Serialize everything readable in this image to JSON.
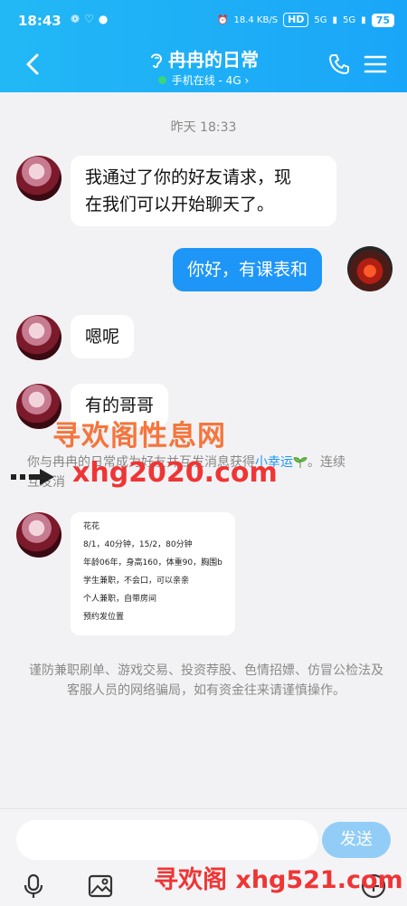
{
  "status_bar": {
    "time": "18:43",
    "speed": "18.4 KB/S",
    "hd": "HD",
    "net1": "5G",
    "net2": "5G",
    "battery": "75"
  },
  "header": {
    "title": "冉冉的日常",
    "status": "手机在线 - 4G",
    "status_chevron": "›"
  },
  "chat": {
    "timestamp": "昨天 18:33",
    "messages": [
      {
        "from": "them",
        "text_line1": "我通过了你的好友请求，现",
        "text_line2": "在我们可以开始聊天了。"
      },
      {
        "from": "me",
        "text": "你好，有课表和"
      },
      {
        "from": "them",
        "text": "嗯呢"
      },
      {
        "from": "them",
        "text": "有的哥哥"
      }
    ],
    "system_notice": {
      "prefix": "你与冉冉的日常成为好友并互发消息获得",
      "link": "小幸运",
      "suffix": "。连续",
      "line2": "互发消"
    },
    "image_card": {
      "lines": [
        "花花",
        "8/1，40分钟，15/2，80分钟",
        "年龄06年，身高160，体重90，胸围b",
        "学生兼职，不会口，可以亲亲",
        "个人兼职，自带房间",
        "预约发位置"
      ]
    },
    "warning": "谨防兼职刷单、游戏交易、投资荐股、色情招嫖、仿冒公检法及客服人员的网络骗局，如有资金往来请谨慎操作。"
  },
  "watermarks": {
    "line1": "寻欢阁性息网",
    "line2": "xhg2020.com",
    "line3": "寻欢阁 xhg521.com"
  },
  "input": {
    "placeholder": "",
    "send_label": "发送"
  },
  "icons": [
    "back-icon",
    "ear-icon",
    "phone-icon",
    "menu-icon",
    "mic-icon",
    "image-icon",
    "plus-icon"
  ],
  "colors": {
    "accent": "#1e96f7",
    "header": "#22b8f5",
    "send_disabled": "#92cdf7"
  }
}
